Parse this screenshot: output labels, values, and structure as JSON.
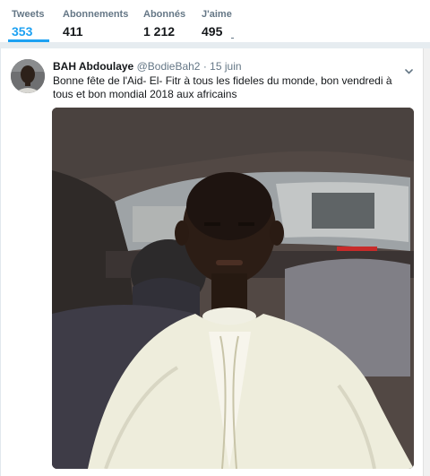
{
  "stats": [
    {
      "label": "Tweets",
      "value": "353",
      "active": true
    },
    {
      "label": "Abonnements",
      "value": "411"
    },
    {
      "label": "Abonnés",
      "value": "1 212"
    },
    {
      "label": "J'aime",
      "value": "495"
    }
  ],
  "tweet": {
    "name": "BAH Abdoulaye",
    "handle": "@BodieBah2",
    "separator": "·",
    "date": "15 juin",
    "text": "Bonne fête de l'Aid- El- Fitr à tous les fideles du monde, bon vendredi à tous et bon mondial 2018 aux africains",
    "caret_icon": "chevron-down-icon"
  },
  "colors": {
    "accent": "#1da1f2",
    "muted": "#657786",
    "background": "#e6ecf0"
  }
}
